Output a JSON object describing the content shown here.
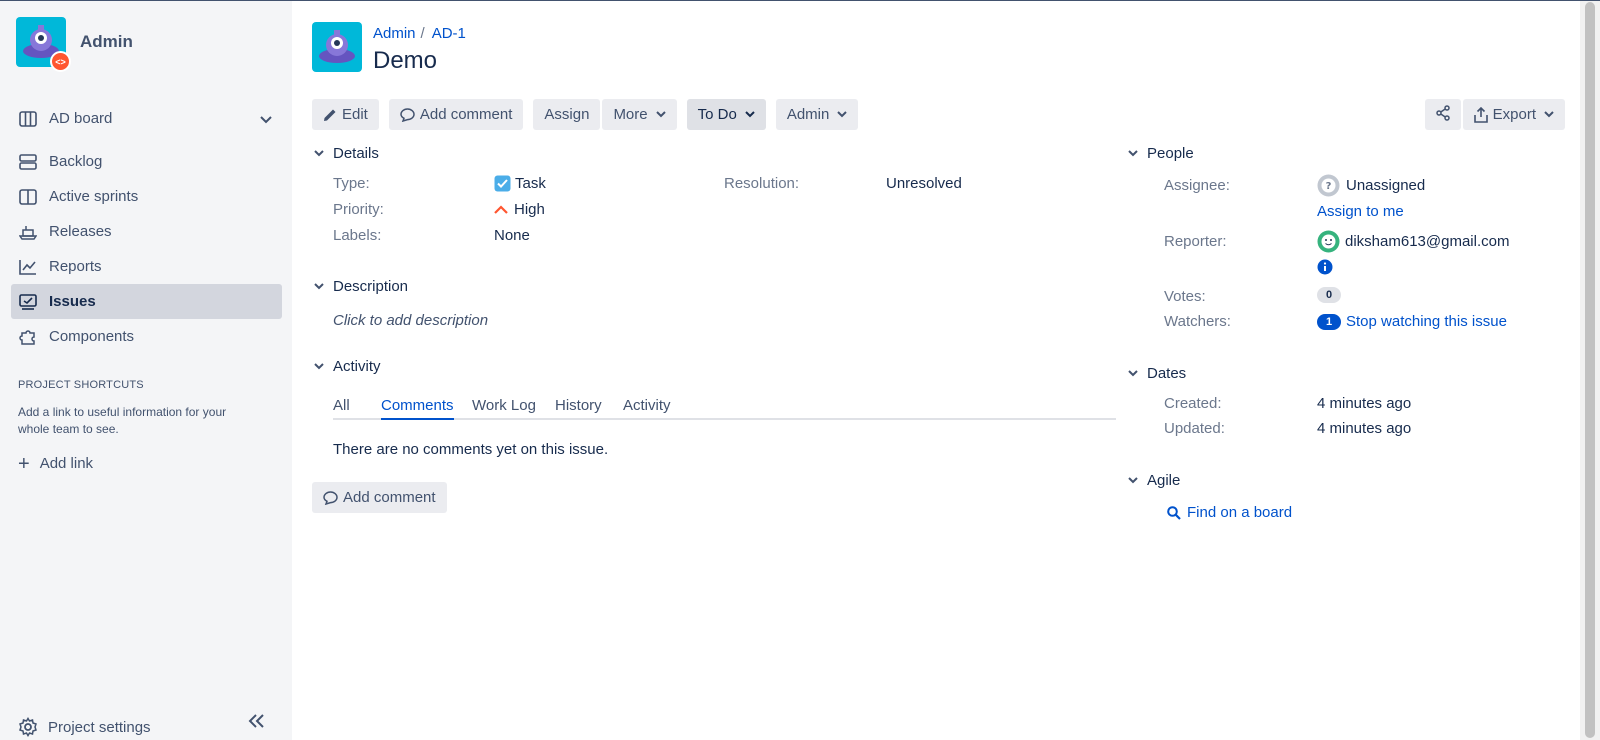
{
  "sidebar": {
    "project_name": "Admin",
    "board_label": "AD board",
    "items": [
      {
        "label": "Backlog"
      },
      {
        "label": "Active sprints"
      },
      {
        "label": "Releases"
      },
      {
        "label": "Reports"
      },
      {
        "label": "Issues"
      },
      {
        "label": "Components"
      }
    ],
    "shortcuts_heading": "PROJECT SHORTCUTS",
    "shortcuts_text": "Add a link to useful information for your whole team to see.",
    "add_link": "Add link",
    "settings": "Project settings"
  },
  "breadcrumb": {
    "project": "Admin",
    "sep": "/",
    "issue_key": "AD-1"
  },
  "issue_title": "Demo",
  "toolbar": {
    "edit": "Edit",
    "add_comment": "Add comment",
    "assign": "Assign",
    "more": "More",
    "status": "To Do",
    "workflow": "Admin",
    "export": "Export"
  },
  "details": {
    "heading": "Details",
    "type_label": "Type:",
    "type_value": "Task",
    "priority_label": "Priority:",
    "priority_value": "High",
    "labels_label": "Labels:",
    "labels_value": "None",
    "resolution_label": "Resolution:",
    "resolution_value": "Unresolved"
  },
  "description": {
    "heading": "Description",
    "placeholder": "Click to add description"
  },
  "activity": {
    "heading": "Activity",
    "tabs": [
      "All",
      "Comments",
      "Work Log",
      "History",
      "Activity"
    ],
    "active_tab": "Comments",
    "empty": "There are no comments yet on this issue.",
    "add_comment": "Add comment"
  },
  "people": {
    "heading": "People",
    "assignee_label": "Assignee:",
    "assignee_value": "Unassigned",
    "assign_to_me": "Assign to me",
    "reporter_label": "Reporter:",
    "reporter_value": "diksham613@gmail.com",
    "votes_label": "Votes:",
    "votes_value": "0",
    "watchers_label": "Watchers:",
    "watchers_value": "1",
    "stop_watching": "Stop watching this issue"
  },
  "dates": {
    "heading": "Dates",
    "created_label": "Created:",
    "created_value": "4 minutes ago",
    "updated_label": "Updated:",
    "updated_value": "4 minutes ago"
  },
  "agile": {
    "heading": "Agile",
    "find_on_board": "Find on a board"
  },
  "colors": {
    "link": "#0052cc",
    "sidebar_bg": "#f4f5f7",
    "priority_high": "#ff5630",
    "avatar": "#00b8d9"
  },
  "icons": [
    "board-icon",
    "backlog-icon",
    "sprints-icon",
    "releases-icon",
    "reports-icon",
    "issues-icon",
    "components-icon",
    "gear-icon",
    "share-icon",
    "export-icon",
    "pencil-icon",
    "comment-icon",
    "search-icon",
    "info-icon"
  ]
}
